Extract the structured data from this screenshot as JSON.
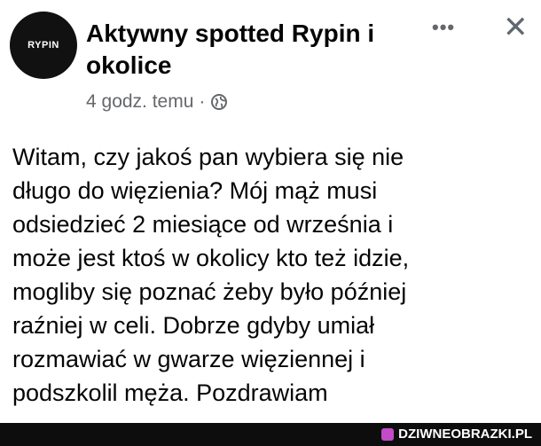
{
  "post": {
    "avatar_text": "RYPIN",
    "group_name": "Aktywny spotted Rypin i okolice",
    "timestamp": "4 godz. temu",
    "separator": "·",
    "more_label": "•••",
    "close_label": "✕",
    "body_lines": [
      "Witam, czy jakoś pan wybiera się nie",
      "długo do więzienia? Mój mąż musi",
      "odsiedzieć 2 miesiące od września i",
      "może jest ktoś w okolicy kto też idzie,",
      "mogliby się poznać żeby było później",
      "raźniej w celi. Dobrze gdyby umiał",
      "rozmawiać w gwarze więziennej i",
      "podszkolil męża. Pozdrawiam"
    ]
  },
  "watermark": {
    "text": "DZIWNEOBRAZKI.PL"
  },
  "icons": {
    "privacy": "globe-icon",
    "menu": "more-options-icon",
    "close": "close-icon"
  },
  "colors": {
    "text": "#050505",
    "secondary": "#65676b",
    "avatar_bg": "#111111",
    "watermark_bar": "#0d0d0d"
  }
}
